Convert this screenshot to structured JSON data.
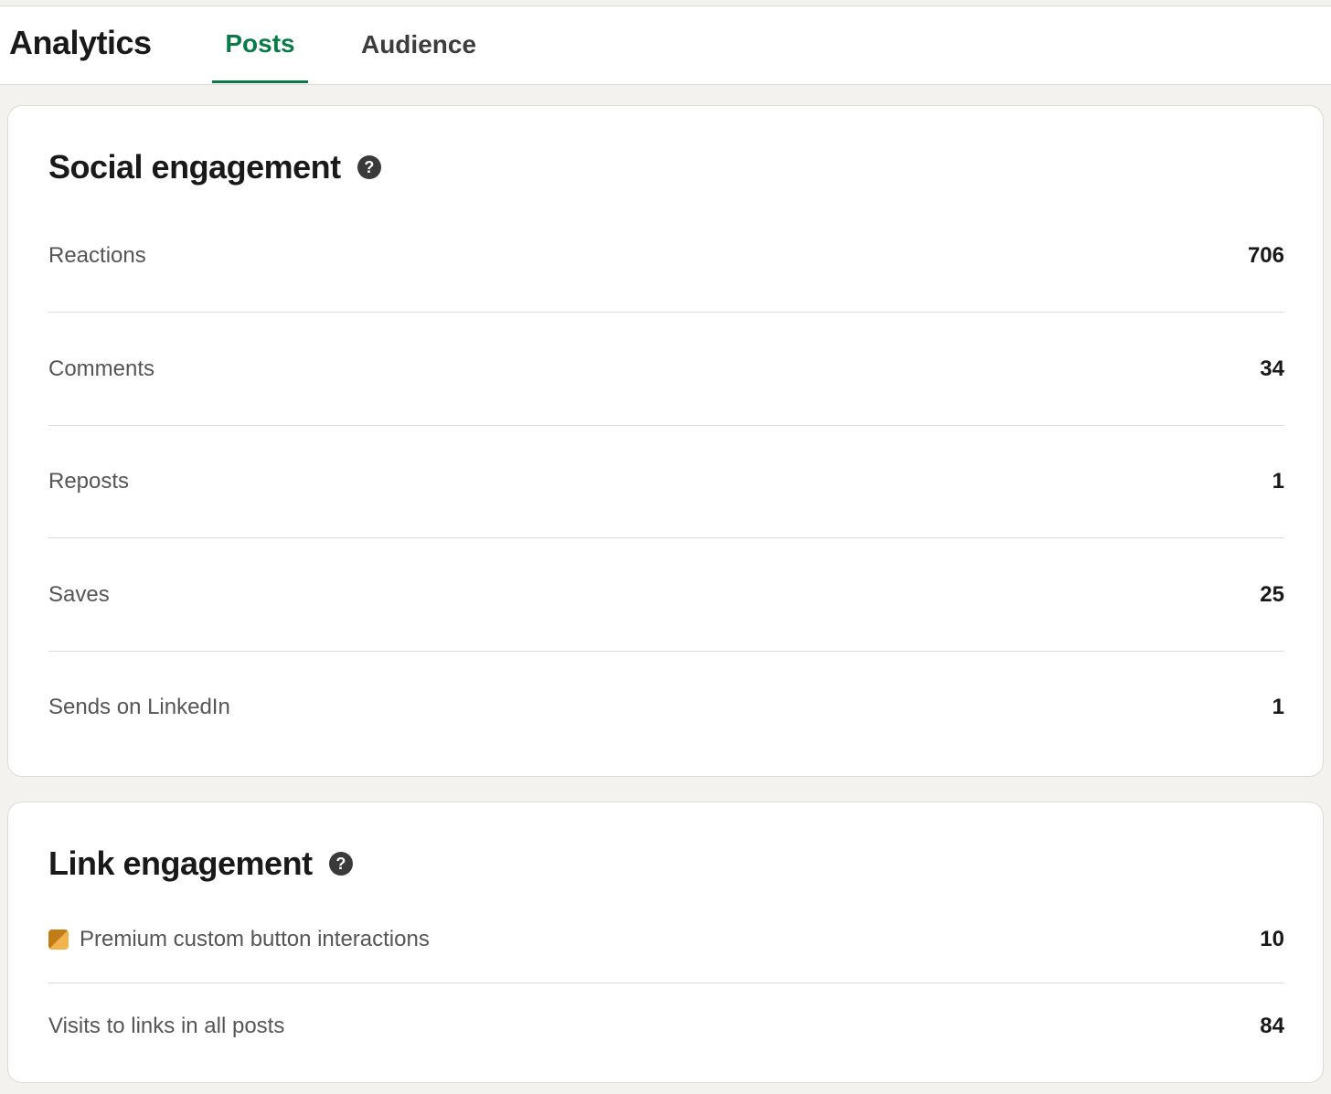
{
  "header": {
    "title": "Analytics",
    "tabs": [
      {
        "label": "Posts",
        "active": true
      },
      {
        "label": "Audience",
        "active": false
      }
    ]
  },
  "social": {
    "title": "Social engagement",
    "help_icon": "question-circle",
    "rows": [
      {
        "label": "Reactions",
        "value": "706"
      },
      {
        "label": "Comments",
        "value": "34"
      },
      {
        "label": "Reposts",
        "value": "1"
      },
      {
        "label": "Saves",
        "value": "25"
      },
      {
        "label": "Sends on LinkedIn",
        "value": "1"
      }
    ]
  },
  "link": {
    "title": "Link engagement",
    "help_icon": "question-circle",
    "rows": [
      {
        "label": "Premium custom button interactions",
        "value": "10",
        "icon": "premium-icon"
      },
      {
        "label": "Visits to links in all posts",
        "value": "84"
      }
    ]
  },
  "colors": {
    "accent": "#0a7a47",
    "premium": "#e5a13a"
  }
}
